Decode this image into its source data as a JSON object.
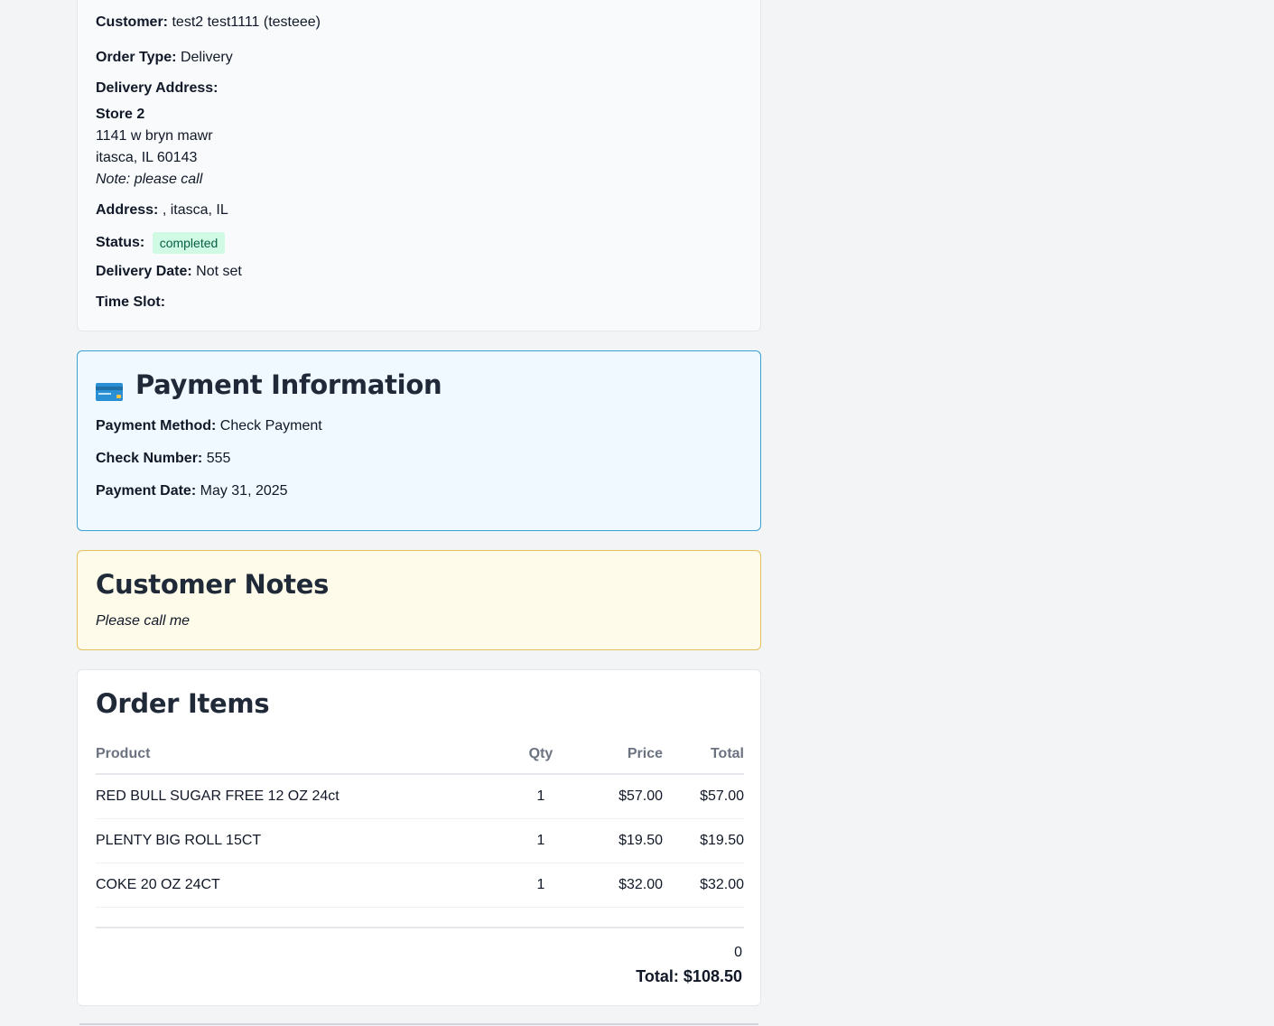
{
  "order_info": {
    "customer_label": "Customer:",
    "customer_value": "test2 test1111 (testeee)",
    "order_type_label": "Order Type:",
    "order_type_value": "Delivery",
    "delivery_address_label": "Delivery Address:",
    "delivery_address": {
      "name": "Store 2",
      "street": "1141 w bryn mawr",
      "city_line": "itasca, IL 60143",
      "note": "Note: please call"
    },
    "address_label": "Address:",
    "address_value": ", itasca, IL",
    "status_label": "Status:",
    "status_value": "completed",
    "delivery_date_label": "Delivery Date:",
    "delivery_date_value": "Not set",
    "time_slot_label": "Time Slot:",
    "time_slot_value": ""
  },
  "payment": {
    "icon": "credit-card-icon",
    "title": "Payment Information",
    "method_label": "Payment Method:",
    "method_value": "Check Payment",
    "check_number_label": "Check Number:",
    "check_number_value": "555",
    "date_label": "Payment Date:",
    "date_value": "May 31, 2025"
  },
  "customer_notes": {
    "title": "Customer Notes",
    "text": "Please call me"
  },
  "order_items": {
    "title": "Order Items",
    "columns": [
      "Product",
      "Qty",
      "Price",
      "Total"
    ],
    "rows": [
      {
        "product": "RED BULL SUGAR FREE 12 OZ 24ct",
        "qty": "1",
        "price": "$57.00",
        "total": "$57.00"
      },
      {
        "product": "PLENTY BIG ROLL 15CT",
        "qty": "1",
        "price": "$19.50",
        "total": "$19.50"
      },
      {
        "product": "COKE 20 OZ 24CT",
        "qty": "1",
        "price": "$32.00",
        "total": "$32.00"
      }
    ],
    "summary_zero": "0",
    "total_text": "Total: $108.50"
  },
  "colors": {
    "page_bg": "#f3f4f6",
    "status_badge_bg": "#d1fae5",
    "status_badge_text": "#065f46",
    "payment_border": "#38a3d1",
    "notes_border": "#e5c15a"
  }
}
